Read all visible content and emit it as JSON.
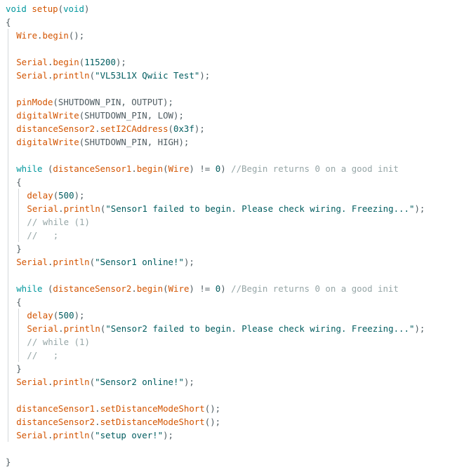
{
  "editor": {
    "colors": {
      "keyword": "#00979d",
      "function": "#d35400",
      "number": "#005c5f",
      "string": "#005c5f",
      "comment": "#95a5a6",
      "plain": "#4e5b61",
      "indent_guide": "#d4d8da"
    },
    "lines": [
      {
        "indent": 0,
        "tokens": [
          [
            "kw",
            "void"
          ],
          [
            "pl",
            " "
          ],
          [
            "fn",
            "setup"
          ],
          [
            "pl",
            "("
          ],
          [
            "kw",
            "void"
          ],
          [
            "pl",
            ")"
          ]
        ]
      },
      {
        "indent": 0,
        "tokens": [
          [
            "pl",
            "{"
          ]
        ]
      },
      {
        "indent": 1,
        "tokens": [
          [
            "fn",
            "Wire"
          ],
          [
            "pl",
            "."
          ],
          [
            "fn",
            "begin"
          ],
          [
            "pl",
            "();"
          ]
        ]
      },
      {
        "indent": 1,
        "tokens": []
      },
      {
        "indent": 1,
        "tokens": [
          [
            "fn",
            "Serial"
          ],
          [
            "pl",
            "."
          ],
          [
            "fn",
            "begin"
          ],
          [
            "pl",
            "("
          ],
          [
            "num",
            "115200"
          ],
          [
            "pl",
            ");"
          ]
        ]
      },
      {
        "indent": 1,
        "tokens": [
          [
            "fn",
            "Serial"
          ],
          [
            "pl",
            "."
          ],
          [
            "fn",
            "println"
          ],
          [
            "pl",
            "("
          ],
          [
            "str",
            "\"VL53L1X Qwiic Test\""
          ],
          [
            "pl",
            ");"
          ]
        ]
      },
      {
        "indent": 1,
        "tokens": []
      },
      {
        "indent": 1,
        "tokens": [
          [
            "fn",
            "pinMode"
          ],
          [
            "pl",
            "(SHUTDOWN_PIN, OUTPUT);"
          ]
        ]
      },
      {
        "indent": 1,
        "tokens": [
          [
            "fn",
            "digitalWrite"
          ],
          [
            "pl",
            "(SHUTDOWN_PIN, LOW);"
          ]
        ]
      },
      {
        "indent": 1,
        "tokens": [
          [
            "fn",
            "distanceSensor2"
          ],
          [
            "pl",
            "."
          ],
          [
            "fn",
            "setI2CAddress"
          ],
          [
            "pl",
            "("
          ],
          [
            "num",
            "0x3f"
          ],
          [
            "pl",
            ");"
          ]
        ]
      },
      {
        "indent": 1,
        "tokens": [
          [
            "fn",
            "digitalWrite"
          ],
          [
            "pl",
            "(SHUTDOWN_PIN, HIGH);"
          ]
        ]
      },
      {
        "indent": 1,
        "tokens": []
      },
      {
        "indent": 1,
        "tokens": [
          [
            "kw",
            "while"
          ],
          [
            "pl",
            " ("
          ],
          [
            "fn",
            "distanceSensor1"
          ],
          [
            "pl",
            "."
          ],
          [
            "fn",
            "begin"
          ],
          [
            "pl",
            "("
          ],
          [
            "fn",
            "Wire"
          ],
          [
            "pl",
            ") != "
          ],
          [
            "num",
            "0"
          ],
          [
            "pl",
            ") "
          ],
          [
            "cm",
            "//Begin returns 0 on a good init"
          ]
        ]
      },
      {
        "indent": 1,
        "tokens": [
          [
            "pl",
            "{"
          ]
        ]
      },
      {
        "indent": 2,
        "tokens": [
          [
            "fn",
            "delay"
          ],
          [
            "pl",
            "("
          ],
          [
            "num",
            "500"
          ],
          [
            "pl",
            ");"
          ]
        ]
      },
      {
        "indent": 2,
        "tokens": [
          [
            "fn",
            "Serial"
          ],
          [
            "pl",
            "."
          ],
          [
            "fn",
            "println"
          ],
          [
            "pl",
            "("
          ],
          [
            "str",
            "\"Sensor1 failed to begin. Please check wiring. Freezing...\""
          ],
          [
            "pl",
            ");"
          ]
        ]
      },
      {
        "indent": 2,
        "tokens": [
          [
            "cm",
            "// while (1)"
          ]
        ]
      },
      {
        "indent": 2,
        "tokens": [
          [
            "cm",
            "//   ;"
          ]
        ]
      },
      {
        "indent": 1,
        "tokens": [
          [
            "pl",
            "}"
          ]
        ]
      },
      {
        "indent": 1,
        "tokens": [
          [
            "fn",
            "Serial"
          ],
          [
            "pl",
            "."
          ],
          [
            "fn",
            "println"
          ],
          [
            "pl",
            "("
          ],
          [
            "str",
            "\"Sensor1 online!\""
          ],
          [
            "pl",
            ");"
          ]
        ]
      },
      {
        "indent": 1,
        "tokens": []
      },
      {
        "indent": 1,
        "tokens": [
          [
            "kw",
            "while"
          ],
          [
            "pl",
            " ("
          ],
          [
            "fn",
            "distanceSensor2"
          ],
          [
            "pl",
            "."
          ],
          [
            "fn",
            "begin"
          ],
          [
            "pl",
            "("
          ],
          [
            "fn",
            "Wire"
          ],
          [
            "pl",
            ") != "
          ],
          [
            "num",
            "0"
          ],
          [
            "pl",
            ") "
          ],
          [
            "cm",
            "//Begin returns 0 on a good init"
          ]
        ]
      },
      {
        "indent": 1,
        "tokens": [
          [
            "pl",
            "{"
          ]
        ]
      },
      {
        "indent": 2,
        "tokens": [
          [
            "fn",
            "delay"
          ],
          [
            "pl",
            "("
          ],
          [
            "num",
            "500"
          ],
          [
            "pl",
            ");"
          ]
        ]
      },
      {
        "indent": 2,
        "tokens": [
          [
            "fn",
            "Serial"
          ],
          [
            "pl",
            "."
          ],
          [
            "fn",
            "println"
          ],
          [
            "pl",
            "("
          ],
          [
            "str",
            "\"Sensor2 failed to begin. Please check wiring. Freezing...\""
          ],
          [
            "pl",
            ");"
          ]
        ]
      },
      {
        "indent": 2,
        "tokens": [
          [
            "cm",
            "// while (1)"
          ]
        ]
      },
      {
        "indent": 2,
        "tokens": [
          [
            "cm",
            "//   ;"
          ]
        ]
      },
      {
        "indent": 1,
        "tokens": [
          [
            "pl",
            "}"
          ]
        ]
      },
      {
        "indent": 1,
        "tokens": [
          [
            "fn",
            "Serial"
          ],
          [
            "pl",
            "."
          ],
          [
            "fn",
            "println"
          ],
          [
            "pl",
            "("
          ],
          [
            "str",
            "\"Sensor2 online!\""
          ],
          [
            "pl",
            ");"
          ]
        ]
      },
      {
        "indent": 1,
        "tokens": []
      },
      {
        "indent": 1,
        "tokens": [
          [
            "fn",
            "distanceSensor1"
          ],
          [
            "pl",
            "."
          ],
          [
            "fn",
            "setDistanceModeShort"
          ],
          [
            "pl",
            "();"
          ]
        ]
      },
      {
        "indent": 1,
        "tokens": [
          [
            "fn",
            "distanceSensor2"
          ],
          [
            "pl",
            "."
          ],
          [
            "fn",
            "setDistanceModeShort"
          ],
          [
            "pl",
            "();"
          ]
        ]
      },
      {
        "indent": 1,
        "tokens": [
          [
            "fn",
            "Serial"
          ],
          [
            "pl",
            "."
          ],
          [
            "fn",
            "println"
          ],
          [
            "pl",
            "("
          ],
          [
            "str",
            "\"setup over!\""
          ],
          [
            "pl",
            ");"
          ]
        ]
      },
      {
        "indent": 0,
        "tokens": []
      },
      {
        "indent": 0,
        "tokens": [
          [
            "pl",
            "}"
          ]
        ]
      }
    ]
  }
}
